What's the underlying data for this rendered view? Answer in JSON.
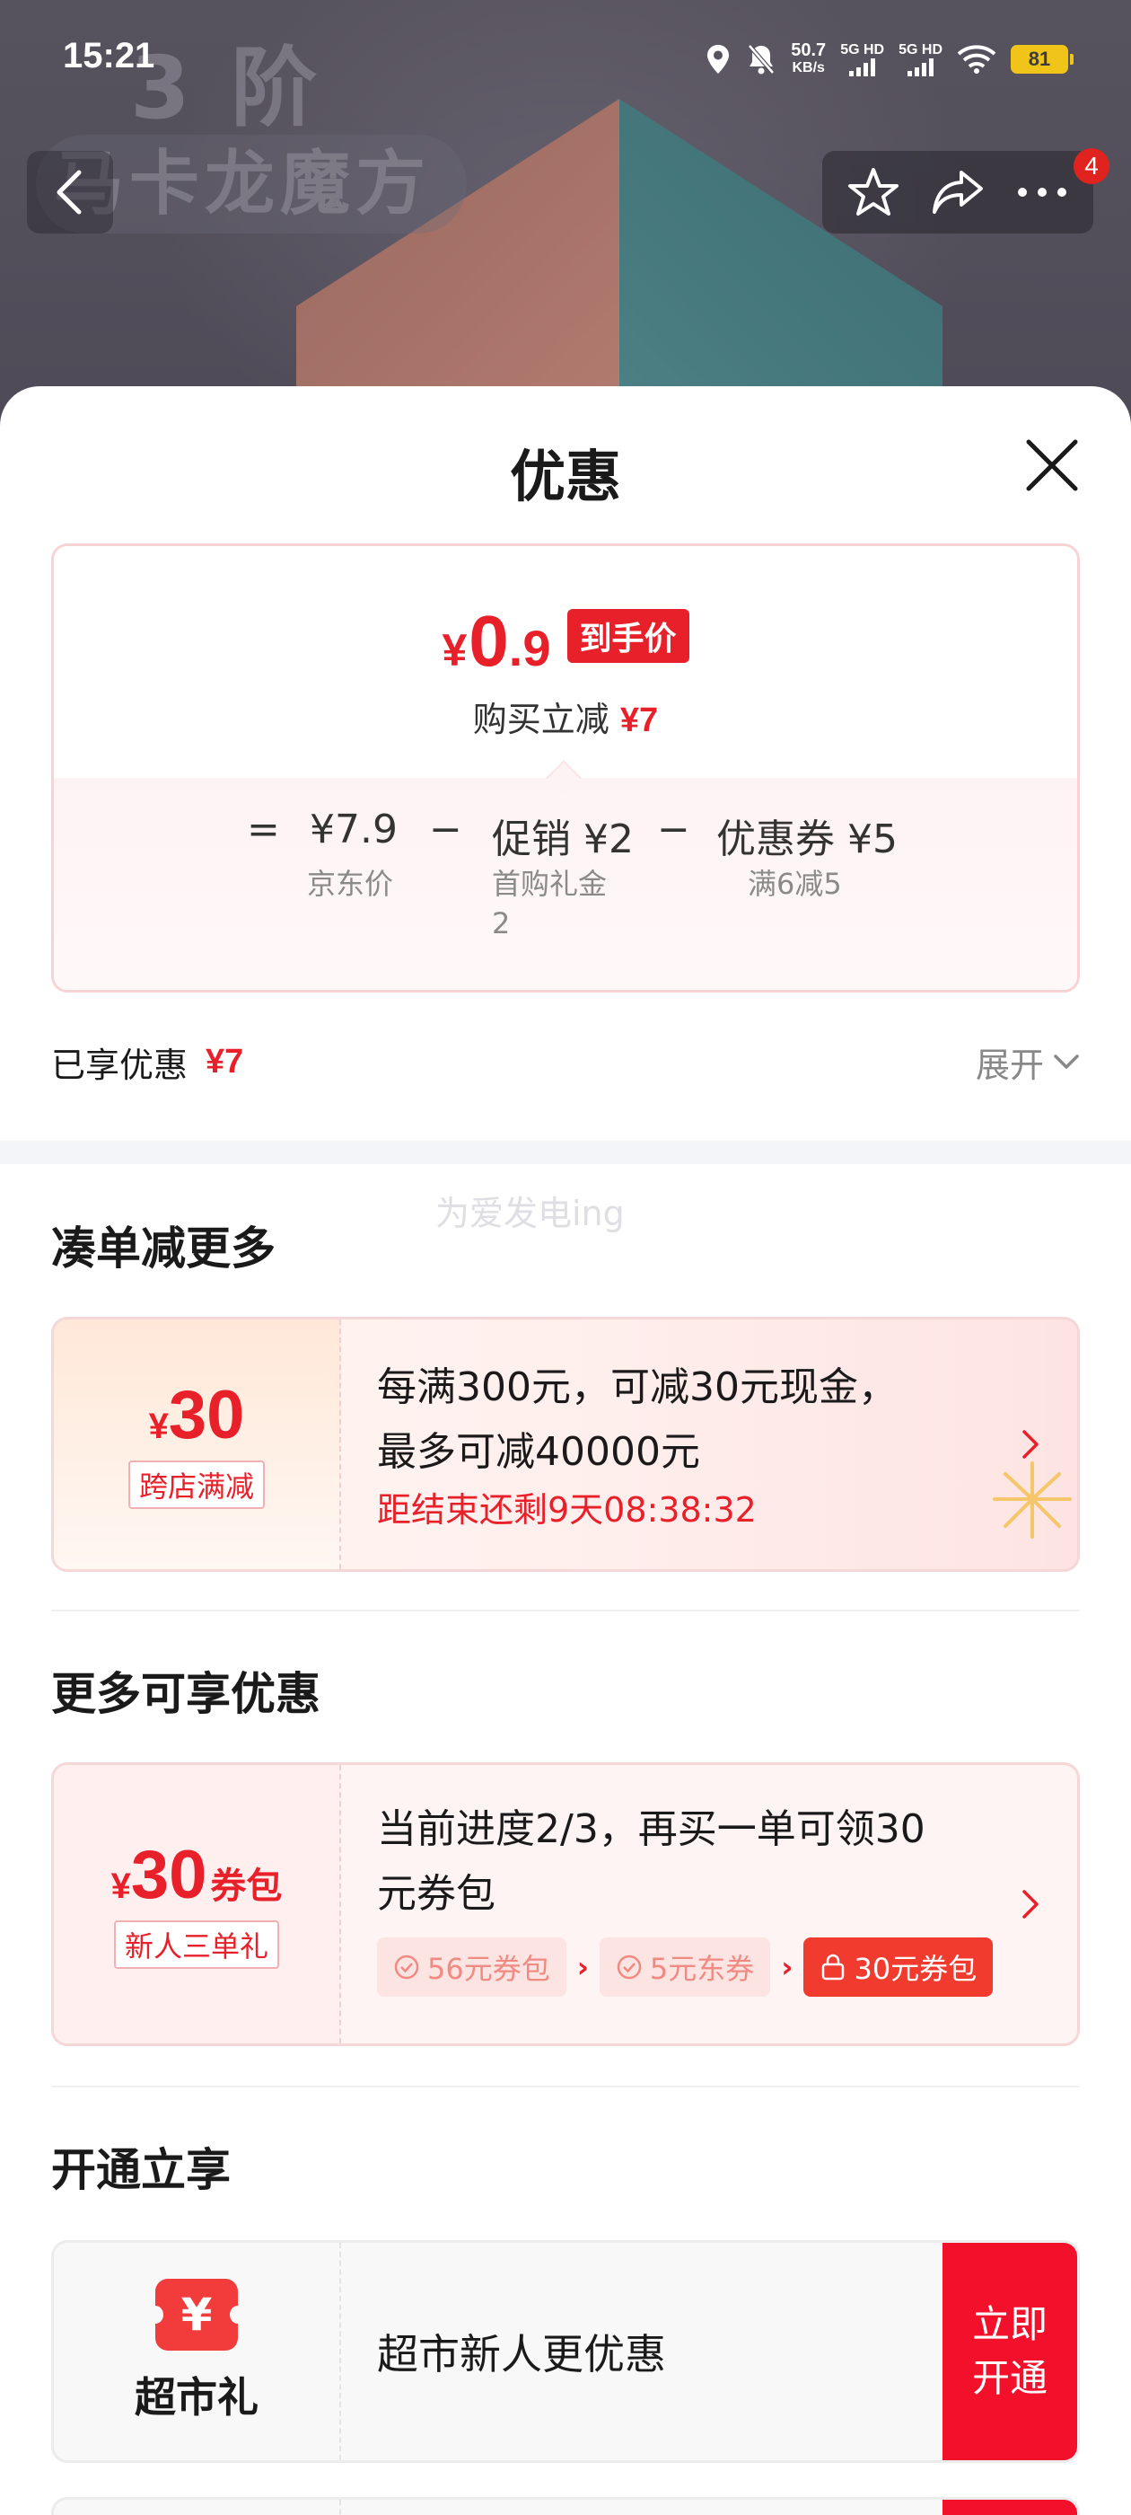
{
  "status_bar": {
    "time": "15:21",
    "net_speed_value": "50.7",
    "net_speed_unit": "KB/s",
    "sim1": "5G HD",
    "sim2": "5G HD",
    "battery": "81",
    "icons": [
      "location-icon",
      "mute-icon",
      "signal-icon",
      "signal-icon",
      "wifi-icon",
      "battery-icon"
    ]
  },
  "background": {
    "title_line1": "3 阶",
    "title_line2": "马卡龙魔方"
  },
  "nav": {
    "badge_count": "4",
    "icons": [
      "back-icon",
      "star-icon",
      "share-icon",
      "more-icon"
    ]
  },
  "sheet": {
    "title": "优惠",
    "close_icon": "close-icon"
  },
  "price": {
    "yen": "¥",
    "final_int": "0",
    "final_dec": ".9",
    "final_tag": "到手价",
    "reduce_label": "购买立减",
    "reduce_value": "¥7",
    "formula": {
      "equals": "=",
      "jd_price": "¥7.9",
      "jd_label": "京东价",
      "minus1": "−",
      "promo": "促销 ¥2",
      "promo_label_line1": "首购礼金",
      "promo_label_line2": "2",
      "minus2": "−",
      "coupon": "优惠券 ¥5",
      "coupon_label": "满6减5"
    }
  },
  "enjoyed": {
    "label": "已享优惠",
    "value": "¥7",
    "expand": "展开"
  },
  "watermark": "为爱发电ing",
  "section_more": {
    "title": "凑单减更多",
    "card": {
      "yen": "¥",
      "amount": "30",
      "tag": "跨店满减",
      "line1": "每满300元，可减30元现金，",
      "line2": "最多可减40000元",
      "countdown": "距结束还剩9天08:38:32"
    }
  },
  "section_enjoy": {
    "title": "更多可享优惠",
    "card": {
      "yen": "¥",
      "amount": "30",
      "unit": "券包",
      "tag": "新人三单礼",
      "line1": "当前进度2/3，再买一单可领30",
      "line2": "元券包",
      "steps": [
        "56元券包",
        "5元东券",
        "30元券包"
      ],
      "progress": "2/3"
    }
  },
  "section_open": {
    "title": "开通立享",
    "card": {
      "icon_glyph": "¥",
      "name": "超市礼",
      "text": "超市新人更优惠",
      "button_line1": "立即",
      "button_line2": "开通"
    }
  },
  "colors": {
    "accent_red": "#e8202a",
    "button_red": "#f2102a",
    "page_bg": "#ffffff",
    "hero_bg": "#57535e",
    "battery_yellow": "#f0c419"
  }
}
